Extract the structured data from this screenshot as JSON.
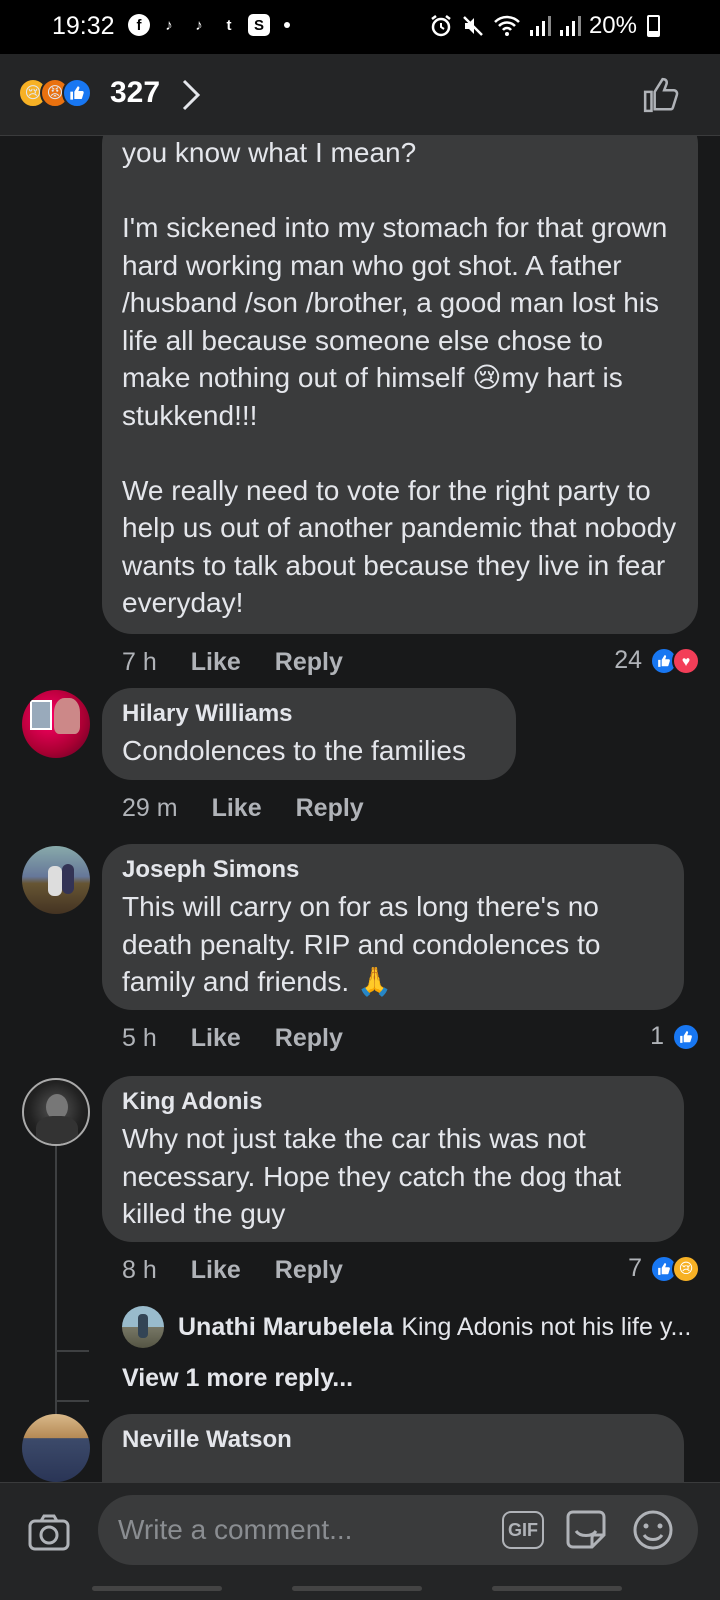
{
  "status_bar": {
    "time": "19:32",
    "apps": [
      "f",
      "♪",
      "♪",
      "t",
      "S"
    ],
    "battery": "20%",
    "battery_level": 0.2
  },
  "reactions": {
    "count": "327",
    "icons": [
      "sad-face-icon",
      "angry-face-icon",
      "like-icon"
    ]
  },
  "comments": [
    {
      "author": "",
      "text": "you know what I mean?\n\nI'm sickened into my stomach for that grown hard working man who got shot. A father /husband /son /brother, a good man lost his life all because someone else chose to make nothing out of himself 😢my hart is stukkend!!!\n\nWe really need to vote for the right party to help us out of another pandemic that nobody wants to talk about because they live in fear everyday!",
      "time": "7 h",
      "like": "Like",
      "reply": "Reply",
      "reaction_count": "24"
    },
    {
      "author": "Hilary Williams",
      "text": "Condolences to the families",
      "time": "29 m",
      "like": "Like",
      "reply": "Reply"
    },
    {
      "author": "Joseph Simons",
      "text": "This will carry on for as long there's no death penalty. RIP and condolences to family and friends. 🙏",
      "time": "5 h",
      "like": "Like",
      "reply": "Reply",
      "reaction_count": "1"
    },
    {
      "author": "King Adonis",
      "text": "Why not just take the car this was not necessary. Hope they catch the dog that killed the guy",
      "time": "8 h",
      "like": "Like",
      "reply": "Reply",
      "reaction_count": "7"
    },
    {
      "author": "Neville Watson"
    }
  ],
  "reply_preview": {
    "author": "Unathi Marubelela",
    "text": "King Adonis not his life y..."
  },
  "view_more": "View 1 more reply...",
  "composer": {
    "placeholder": "Write a comment...",
    "gif_label": "GIF"
  },
  "colors": {
    "background": "#18191a",
    "bubble": "#3a3b3c",
    "like_blue": "#1877f2",
    "love_red": "#f33e58"
  }
}
